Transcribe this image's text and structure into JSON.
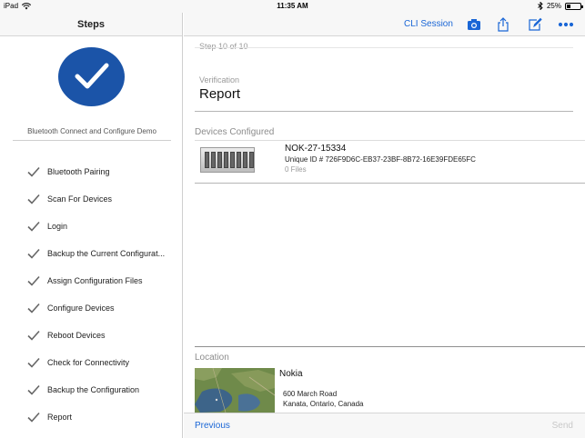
{
  "status_bar": {
    "carrier": "iPad",
    "time": "11:35 AM",
    "battery_percent_text": "25%",
    "battery_level": 0.25
  },
  "sidebar": {
    "title": "Steps",
    "demo_name": "Bluetooth Connect and Configure Demo",
    "steps": [
      {
        "label": "Bluetooth Pairing"
      },
      {
        "label": "Scan For Devices"
      },
      {
        "label": "Login"
      },
      {
        "label": "Backup the Current Configurat..."
      },
      {
        "label": "Assign Configuration Files"
      },
      {
        "label": "Configure Devices"
      },
      {
        "label": "Reboot Devices"
      },
      {
        "label": "Check for Connectivity"
      },
      {
        "label": "Backup the Configuration"
      },
      {
        "label": "Report"
      }
    ]
  },
  "toolbar": {
    "cli_session_label": "CLI Session",
    "icons": [
      "camera-icon",
      "share-icon",
      "edit-icon",
      "more-icon"
    ]
  },
  "main": {
    "step_counter": "Step 10 of 10",
    "section_label": "Verification",
    "section_title": "Report",
    "devices_configured_label": "Devices Configured",
    "device": {
      "name": "NOK-27-15334",
      "unique_id": "Unique ID # 726F9D6C-EB37-23BF-8B72-16E39FDE65FC",
      "files": "0 Files"
    },
    "location_label": "Location",
    "location": {
      "name": "Nokia",
      "address_line1": "600 March Road",
      "address_line2": "Kanata, Ontario, Canada"
    }
  },
  "footer": {
    "previous_label": "Previous",
    "send_label": "Send"
  },
  "colors": {
    "accent": "#1a66d6",
    "logo_blue": "#1b54a8",
    "disabled": "#c8c8c8"
  }
}
